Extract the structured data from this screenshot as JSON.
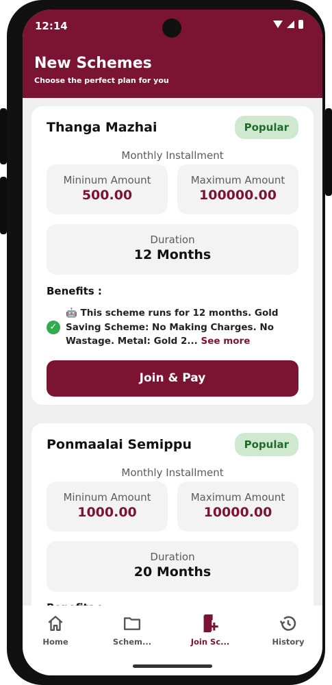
{
  "status_bar": {
    "time": "12:14"
  },
  "header": {
    "title": "New Schemes",
    "subtitle": "Choose the perfect plan for you"
  },
  "schemes": [
    {
      "name": "Thanga Mazhai",
      "badge": "Popular",
      "installment_label": "Monthly Installment",
      "min_label": "Mininum Amount",
      "min_value": "500.00",
      "max_label": "Maximum Amount",
      "max_value": "100000.00",
      "duration_label": "Duration",
      "duration_value": "12 Months",
      "benefits_title": "Benefits :",
      "benefit_text": "🤖 This scheme runs for 12 months. Gold Saving Scheme: No Making Charges. No Wastage. Metal: Gold 2...",
      "see_more": "See more",
      "join_label": "Join & Pay"
    },
    {
      "name": "Ponmaalai Semippu",
      "badge": "Popular",
      "installment_label": "Monthly Installment",
      "min_label": "Mininum Amount",
      "min_value": "1000.00",
      "max_label": "Maximum Amount",
      "max_value": "10000.00",
      "duration_label": "Duration",
      "duration_value": "20 Months",
      "benefits_title": "Benefits :"
    }
  ],
  "nav": [
    {
      "label": "Home",
      "icon": "home-icon"
    },
    {
      "label": "Schem...",
      "icon": "folder-icon"
    },
    {
      "label": "Join Sc...",
      "icon": "add-document-icon",
      "active": true
    },
    {
      "label": "History",
      "icon": "history-icon"
    }
  ],
  "colors": {
    "primary": "#7b1433",
    "badge_bg": "#cfe9d1",
    "badge_text": "#1f6b2a",
    "success": "#2eac4e"
  }
}
